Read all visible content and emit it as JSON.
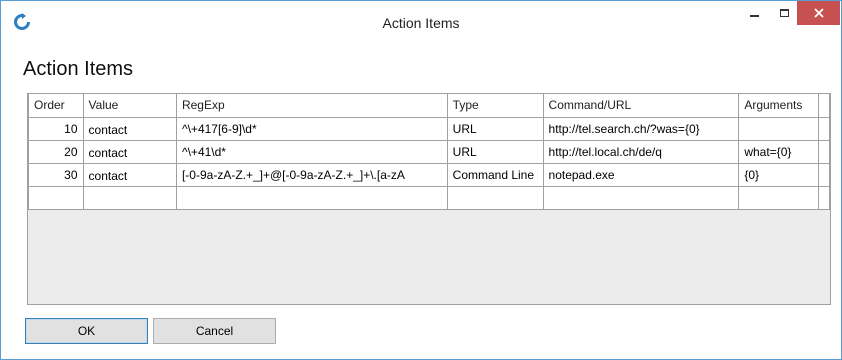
{
  "window": {
    "title": "Action Items",
    "accent": "#5a9fd4",
    "close_color": "#c75050",
    "icons": {
      "app": "refresh-icon",
      "minimize": "minimize-icon",
      "maximize": "maximize-icon",
      "close": "close-icon"
    }
  },
  "heading": "Action Items",
  "grid": {
    "columns": [
      "Order",
      "Value",
      "RegExp",
      "Type",
      "Command/URL",
      "Arguments"
    ],
    "rows": [
      {
        "order": "10",
        "value": "contact",
        "regexp": "^\\+417[6-9]\\d*",
        "type": "URL",
        "command": "http://tel.search.ch/?was={0}",
        "arguments": ""
      },
      {
        "order": "20",
        "value": "contact",
        "regexp": "^\\+41\\d*",
        "type": "URL",
        "command": "http://tel.local.ch/de/q",
        "arguments": "what={0}"
      },
      {
        "order": "30",
        "value": "contact",
        "regexp": "[-0-9a-zA-Z.+_]+@[-0-9a-zA-Z.+_]+\\.[a-zA",
        "type": "Command Line",
        "command": "notepad.exe",
        "arguments": "{0}"
      }
    ]
  },
  "buttons": {
    "ok": "OK",
    "cancel": "Cancel"
  }
}
